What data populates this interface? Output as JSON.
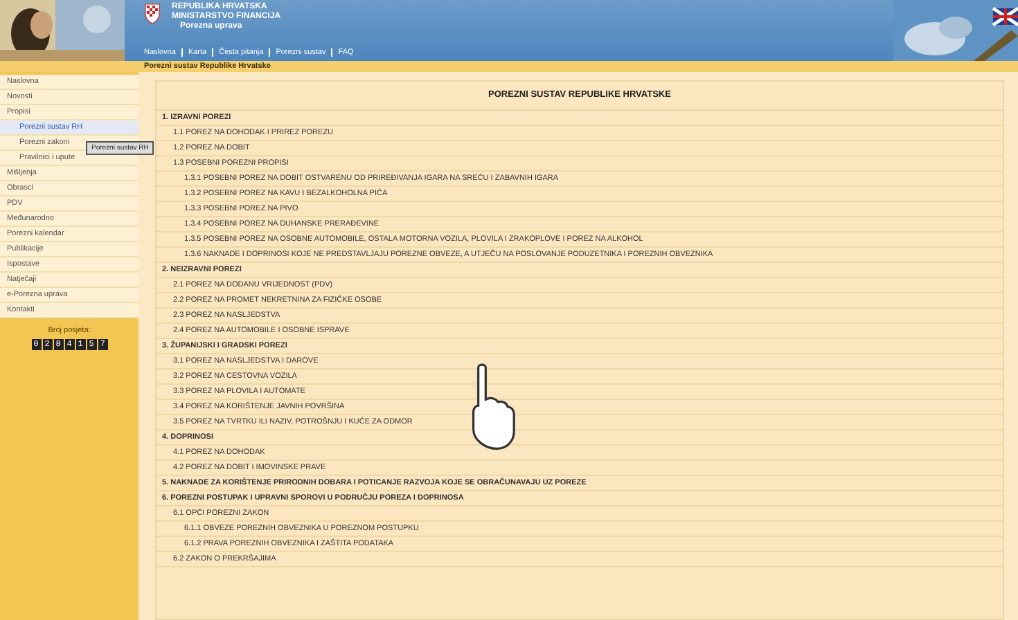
{
  "header": {
    "lines": [
      "REPUBLIKA HRVATSKA",
      "MINISTARSTVO FINANCIJA",
      "Porezna uprava"
    ],
    "breadcrumb": [
      "Naslovna",
      "Karta",
      "Česta pitanja",
      "Porezni sustav",
      "FAQ"
    ],
    "page_bar": "Porezni sustav Republike Hrvatske"
  },
  "sidebar": {
    "items": [
      {
        "label": "Naslovna",
        "selected": false
      },
      {
        "label": "Novosti",
        "selected": false
      },
      {
        "label": "Propisi",
        "selected": false,
        "children": [
          {
            "label": "Porezni sustav RH",
            "selected": true
          },
          {
            "label": "Porezni zakoni",
            "selected": false
          },
          {
            "label": "Pravilnici i upute",
            "selected": false
          }
        ]
      },
      {
        "label": "Mišljenja",
        "selected": false
      },
      {
        "label": "Obrasci",
        "selected": false
      },
      {
        "label": "PDV",
        "selected": false
      },
      {
        "label": "Međunarodno",
        "selected": false
      },
      {
        "label": "Porezni kalendar",
        "selected": false
      },
      {
        "label": "Publikacije",
        "selected": false
      },
      {
        "label": "Ispostave",
        "selected": false
      },
      {
        "label": "Natječaji",
        "selected": false
      },
      {
        "label": "e-Porezna uprava",
        "selected": false
      },
      {
        "label": "Kontakti",
        "selected": false
      }
    ],
    "tooltip": "Porezni sustav RH",
    "counter_label": "Broj posjeta:",
    "counter_digits": [
      "0",
      "2",
      "8",
      "4",
      "1",
      "5",
      "7"
    ]
  },
  "main": {
    "title": "POREZNI SUSTAV REPUBLIKE HRVATSKE",
    "sections": [
      {
        "label": "1. IZRAVNI POREZI",
        "children": [
          {
            "label": "1.1 POREZ NA DOHODAK I PRIREZ POREZU"
          },
          {
            "label": "1.2 POREZ NA DOBIT"
          },
          {
            "label": "1.3 POSEBNI POREZNI PROPISI",
            "children": [
              {
                "label": "1.3.1 POSEBNI POREZ NA DOBIT OSTVARENU OD PRIREĐIVANJA IGARA NA SREĆU I ZABAVNIH IGARA"
              },
              {
                "label": "1.3.2 POSEBNI POREZ NA KAVU I BEZALKOHOLNA PIĆA"
              },
              {
                "label": "1.3.3 POSEBNI POREZ NA PIVO"
              },
              {
                "label": "1.3.4 POSEBNI POREZ NA DUHANSKE PRERAĐEVINE"
              },
              {
                "label": "1.3.5 POSEBNI POREZ NA OSOBNE AUTOMOBILE, OSTALA MOTORNA VOZILA, PLOVILA I ZRAKOPLOVE I POREZ NA ALKOHOL"
              },
              {
                "label": "1.3.6 NAKNADE I DOPRINOSI KOJE NE PREDSTAVLJAJU POREZNE OBVEZE, A UTJEČU NA POSLOVANJE PODUZETNIKA I POREZNIH OBVEZNIKA"
              }
            ]
          }
        ]
      },
      {
        "label": "2. NEIZRAVNI POREZI",
        "children": [
          {
            "label": "2.1 POREZ NA DODANU VRIJEDNOST (PDV)"
          },
          {
            "label": "2.2 POREZ NA PROMET NEKRETNINA ZA FIZIČKE OSOBE"
          },
          {
            "label": "2.3 POREZ NA NASLJEDSTVA"
          },
          {
            "label": "2.4 POREZ NA AUTOMOBILE I OSOBNE ISPRAVE"
          }
        ]
      },
      {
        "label": "3. ŽUPANIJSKI I GRADSKI POREZI",
        "children": [
          {
            "label": "3.1 POREZ NA NASLJEDSTVA I DAROVE"
          },
          {
            "label": "3.2 POREZ NA CESTOVNA VOZILA"
          },
          {
            "label": "3.3 POREZ NA PLOVILA I AUTOMATE"
          },
          {
            "label": "3.4 POREZ NA KORIŠTENJE JAVNIH POVRŠINA"
          },
          {
            "label": "3.5 POREZ NA TVRTKU ILI NAZIV, POTROŠNJU I KUĆE ZA ODMOR"
          }
        ]
      },
      {
        "label": "4. DOPRINOSI",
        "children": [
          {
            "label": "4.1 POREZ NA DOHODAK"
          },
          {
            "label": "4.2 POREZ NA DOBIT I IMOVINSKE PRAVE"
          }
        ]
      },
      {
        "label": "5. NAKNADE ZA KORIŠTENJE PRIRODNIH DOBARA I POTICANJE RAZVOJA KOJE SE OBRAČUNAVAJU UZ POREZE"
      },
      {
        "label": "6. POREZNI POSTUPAK I UPRAVNI SPOROVI U PODRUČJU POREZA I DOPRINOSA",
        "children": [
          {
            "label": "6.1 OPĆI POREZNI ZAKON",
            "children": [
              {
                "label": "6.1.1 OBVEZE POREZNIH OBVEZNIKA U POREZNOM POSTUPKU"
              },
              {
                "label": "6.1.2 PRAVA POREZNIH OBVEZNIKA I ZAŠTITA PODATAKA"
              }
            ]
          },
          {
            "label": "6.2 ZAKON O PREKRŠAJIMA"
          }
        ]
      }
    ]
  }
}
